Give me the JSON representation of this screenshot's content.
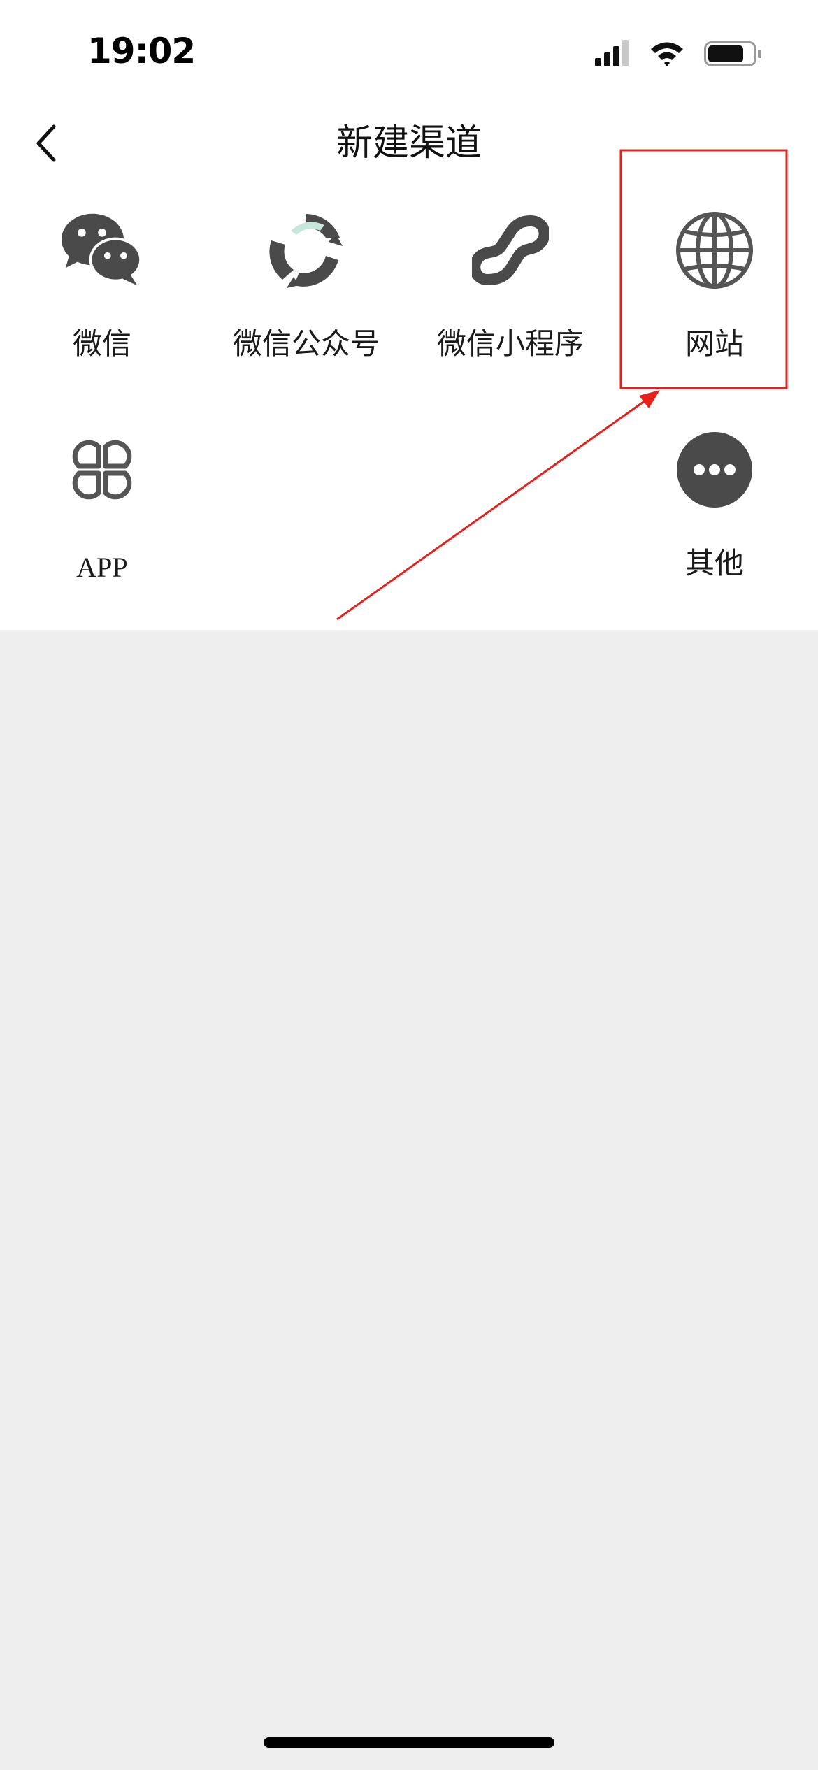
{
  "status_bar": {
    "time": "19:02",
    "icons": [
      "signal-icon",
      "wifi-icon",
      "battery-icon"
    ]
  },
  "nav": {
    "back_icon": "chevron-left-icon",
    "title": "新建渠道"
  },
  "channels": [
    {
      "label": "微信",
      "icon": "wechat-icon"
    },
    {
      "label": "微信公众号",
      "icon": "official-account-icon"
    },
    {
      "label": "微信小程序",
      "icon": "mini-program-icon"
    },
    {
      "label": "网站",
      "icon": "globe-icon",
      "highlighted": true
    },
    {
      "label": "APP",
      "icon": "app-grid-icon"
    },
    {
      "label": "其他",
      "icon": "more-icon"
    }
  ],
  "colors": {
    "icon_gray": "#555555",
    "annotation_red": "#e8201c",
    "page_background": "#eeeeee",
    "panel_background": "#ffffff"
  }
}
